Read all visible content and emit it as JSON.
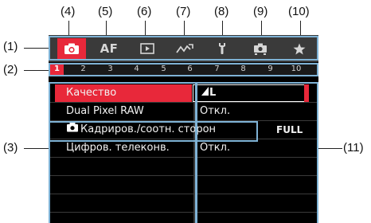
{
  "callouts": [
    "(1)",
    "(2)",
    "(3)",
    "(4)",
    "(5)",
    "(6)",
    "(7)",
    "(8)",
    "(9)",
    "(10)",
    "(11)"
  ],
  "tabs": [
    {
      "name": "shooting-tab",
      "icon": "camera-icon",
      "active": true
    },
    {
      "name": "af-tab",
      "label": "AF"
    },
    {
      "name": "playback-tab",
      "icon": "playback-icon"
    },
    {
      "name": "wireless-tab",
      "icon": "wireless-icon"
    },
    {
      "name": "setup-tab",
      "icon": "wrench-icon"
    },
    {
      "name": "custom-function-tab",
      "icon": "custom-camera-icon"
    },
    {
      "name": "my-menu-tab",
      "icon": "star-icon"
    }
  ],
  "pages": [
    "1",
    "2",
    "3",
    "4",
    "5",
    "6",
    "7",
    "8",
    "9",
    "10"
  ],
  "active_page": "1",
  "menu": [
    {
      "label": "Качество",
      "value": "L",
      "value_icon": "jpeg-large-fine-icon",
      "selected": true
    },
    {
      "label": "Dual Pixel RAW",
      "value": "Откл."
    },
    {
      "label": "Кадриров./соотн. сторон",
      "label_icon": "camera-icon",
      "value": "FULL"
    },
    {
      "label": "Цифров. телеконв.",
      "value": "Откл."
    }
  ],
  "colors": {
    "accent": "#e8283a",
    "tab_bar": "#3a3a3a",
    "highlight": "#7fb3d6"
  }
}
